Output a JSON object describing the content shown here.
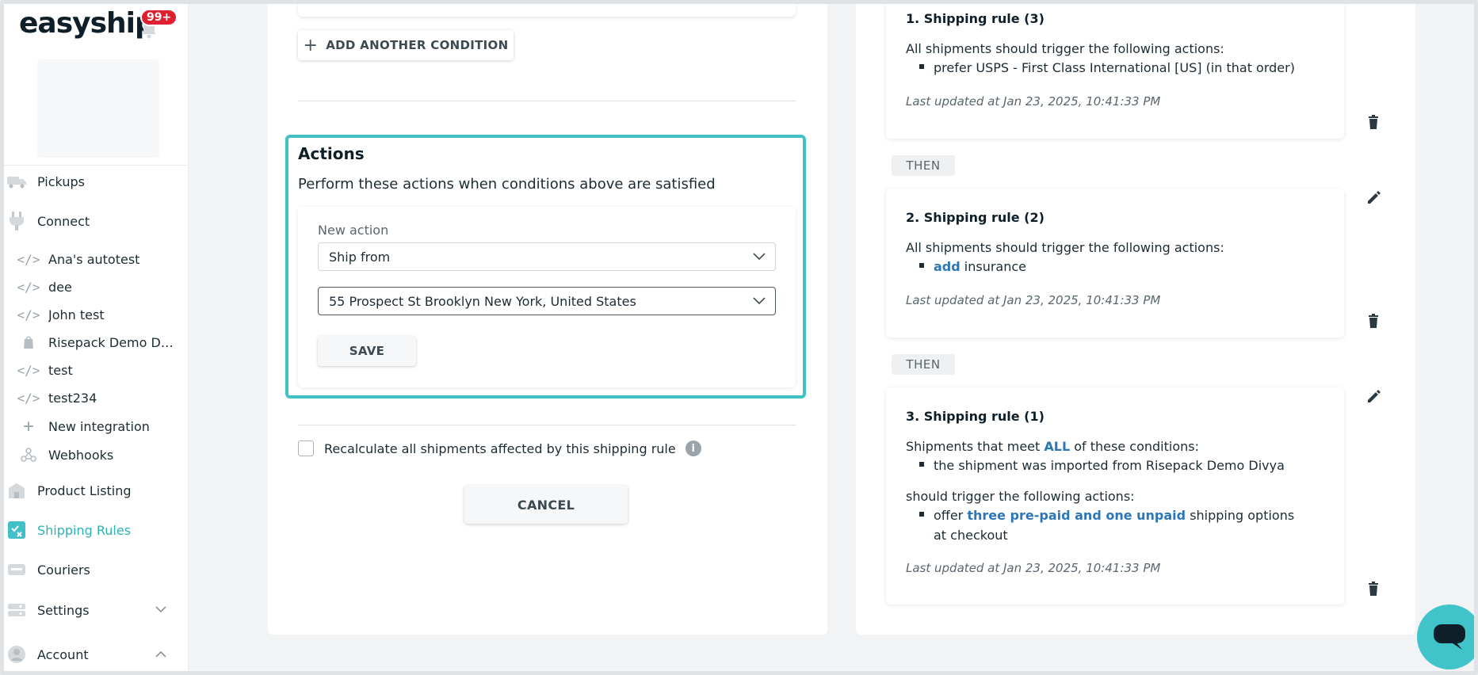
{
  "sidebar": {
    "logo": "easyship",
    "notifications_badge": "99+",
    "items": [
      {
        "label": "Pickups",
        "icon": "truck-icon"
      },
      {
        "label": "Connect",
        "icon": "plug-icon"
      },
      {
        "label": "Product Listing",
        "icon": "store-icon"
      },
      {
        "label": "Shipping Rules",
        "icon": "rules-icon",
        "active": true
      },
      {
        "label": "Couriers",
        "icon": "courier-icon"
      },
      {
        "label": "Settings",
        "icon": "settings-icon"
      },
      {
        "label": "Account",
        "icon": "user-icon"
      }
    ],
    "connect_items": [
      {
        "label": "Ana's autotest",
        "icon": "code-icon"
      },
      {
        "label": "dee",
        "icon": "code-icon"
      },
      {
        "label": "John test",
        "icon": "code-icon"
      },
      {
        "label": "Risepack Demo Di...",
        "icon": "shopify-icon"
      },
      {
        "label": "test",
        "icon": "code-icon"
      },
      {
        "label": "test234",
        "icon": "code-icon"
      },
      {
        "label": "New integration",
        "icon": "plus-icon"
      },
      {
        "label": "Webhooks",
        "icon": "webhook-icon"
      }
    ]
  },
  "editor": {
    "add_condition_label": "ADD ANOTHER CONDITION",
    "actions_title": "Actions",
    "actions_description": "Perform these actions when conditions above are satisfied",
    "new_action_label": "New action",
    "action_type_value": "Ship from",
    "ship_from_value": "55 Prospect St Brooklyn New York, United States",
    "save_label": "SAVE",
    "recalculate_label": "Recalculate all shipments affected by this shipping rule",
    "cancel_label": "CANCEL"
  },
  "rules": [
    {
      "title": "1. Shipping rule (3)",
      "intro": "All shipments should trigger the following actions:",
      "bullet_pre": "prefer USPS - First Class International [US] (in that order)",
      "updated": "Last updated at Jan 23, 2025, 10:41:33 PM"
    },
    {
      "title": "2. Shipping rule (2)",
      "intro": "All shipments should trigger the following actions:",
      "bullet_hl": "add",
      "bullet_post": " insurance",
      "updated": "Last updated at Jan 23, 2025, 10:41:33 PM"
    },
    {
      "title": "3. Shipping rule (1)",
      "intro_pre": "Shipments that meet ",
      "intro_hl": "ALL",
      "intro_post": " of these conditions:",
      "condition": "the shipment was imported from Risepack Demo Divya",
      "actions_intro": "should trigger the following actions:",
      "action_pre": "offer ",
      "action_hl": "three pre-paid and one unpaid",
      "action_post": " shipping options at checkout",
      "updated": "Last updated at Jan 23, 2025, 10:41:33 PM"
    }
  ],
  "then_label": "THEN",
  "colors": {
    "accent": "#41c1c7",
    "active_nav": "#2eb2b8",
    "link": "#2b77b9",
    "badge": "#e0202f"
  }
}
